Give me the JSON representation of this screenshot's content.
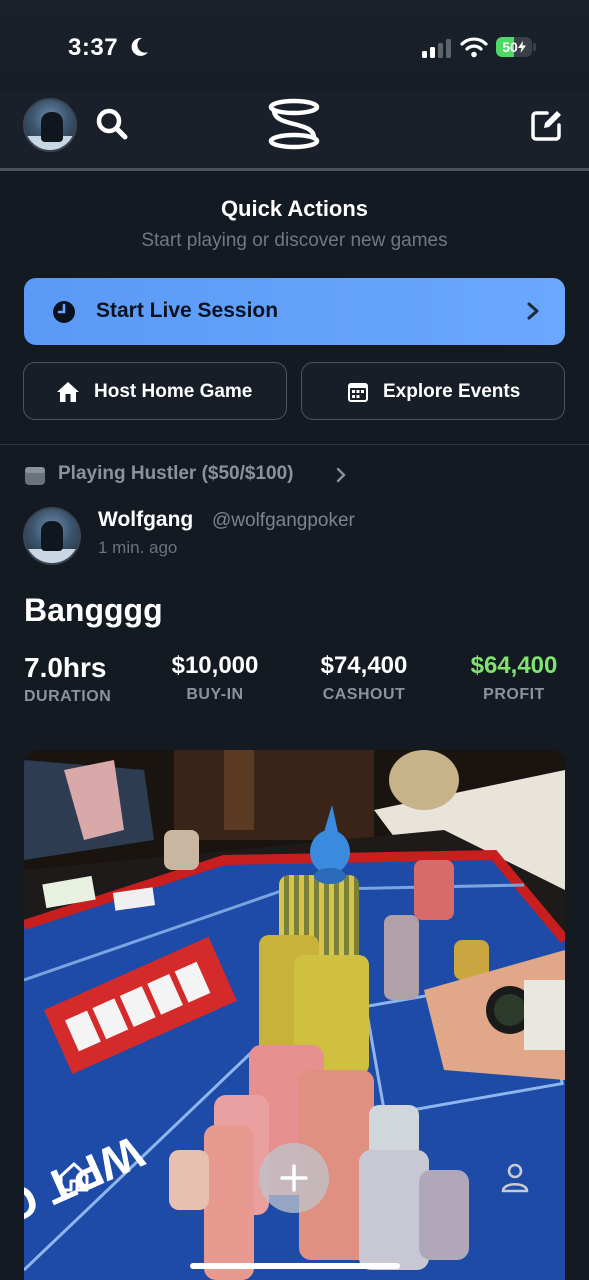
{
  "status_bar": {
    "time": "3:37",
    "battery": "50",
    "battery_level": 0.5
  },
  "header": {
    "search_icon": "search-icon",
    "logo": "app-logo",
    "compose_icon": "compose-icon"
  },
  "quick_actions": {
    "title": "Quick Actions",
    "subtitle": "Start playing or discover new games",
    "start_live_session": "Start Live Session",
    "host_home_game": "Host Home Game",
    "explore_events": "Explore Events"
  },
  "post": {
    "playing_label": "Playing Hustler ($50/$100)",
    "author_name": "Wolfgang",
    "author_handle": "@wolfgangpoker",
    "timestamp": "1 min. ago",
    "title": "Bangggg",
    "stats": {
      "duration_value": "7.0hrs",
      "duration_label": "DURATION",
      "buyin_value": "$10,000",
      "buyin_label": "BUY-IN",
      "cashout_value": "$74,400",
      "cashout_label": "CASHOUT",
      "profit_value": "$64,400",
      "profit_label": "PROFIT"
    },
    "photo_table_text": "WPT Global"
  },
  "colors": {
    "background": "#141a22",
    "accent_blue": "#5a9af5",
    "profit_green": "#7ee46d",
    "muted_text": "#8a929c"
  }
}
